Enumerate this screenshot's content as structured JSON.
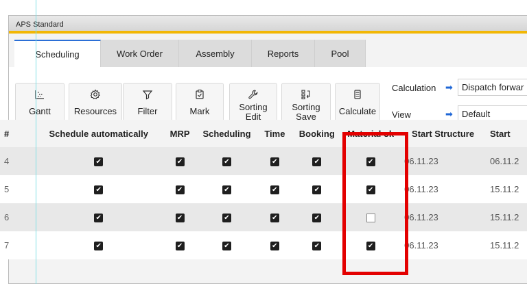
{
  "window": {
    "title": "APS Standard"
  },
  "tabs": [
    {
      "label": "Scheduling"
    },
    {
      "label": "Work Order"
    },
    {
      "label": "Assembly"
    },
    {
      "label": "Reports"
    },
    {
      "label": "Pool"
    }
  ],
  "toolbar": {
    "gantt": {
      "label": "Gantt",
      "icon": "gantt-icon"
    },
    "resources": {
      "label": "Resources",
      "icon": "gear-icon"
    },
    "filter": {
      "label": "Filter",
      "icon": "filter-icon"
    },
    "mark": {
      "label": "Mark",
      "icon": "clipboard-check-icon"
    },
    "sorting_edit": {
      "line1": "Sorting",
      "line2": "Edit",
      "icon": "wrench-icon"
    },
    "sorting_save": {
      "line1": "Sorting",
      "line2": "Save",
      "icon": "sort-icon"
    },
    "calculate": {
      "label": "Calculate",
      "icon": "calculator-icon"
    }
  },
  "settings": {
    "calculation": {
      "label": "Calculation",
      "value": "Dispatch forwar"
    },
    "view": {
      "label": "View",
      "value": "Default"
    }
  },
  "table": {
    "headers": [
      "#",
      "Schedule automatically",
      "MRP",
      "Scheduling",
      "Time",
      "Booking",
      "Material ok",
      "Start Structure",
      "Start"
    ],
    "rows": [
      {
        "num": "4",
        "schedule_auto": true,
        "mrp": true,
        "scheduling": true,
        "time": true,
        "booking": true,
        "material_ok": true,
        "start_structure": "06.11.23",
        "start": "06.11.2"
      },
      {
        "num": "5",
        "schedule_auto": true,
        "mrp": true,
        "scheduling": true,
        "time": true,
        "booking": true,
        "material_ok": true,
        "start_structure": "06.11.23",
        "start": "15.11.2"
      },
      {
        "num": "6",
        "schedule_auto": true,
        "mrp": true,
        "scheduling": true,
        "time": true,
        "booking": true,
        "material_ok": false,
        "start_structure": "06.11.23",
        "start": "15.11.2"
      },
      {
        "num": "7",
        "schedule_auto": true,
        "mrp": true,
        "scheduling": true,
        "time": true,
        "booking": true,
        "material_ok": true,
        "start_structure": "06.11.23",
        "start": "15.11.2"
      }
    ]
  },
  "colors": {
    "accent": "#f2b705",
    "tab_active": "#2b6fd6",
    "highlight": "#e30000",
    "arrow": "#1e66d6"
  }
}
